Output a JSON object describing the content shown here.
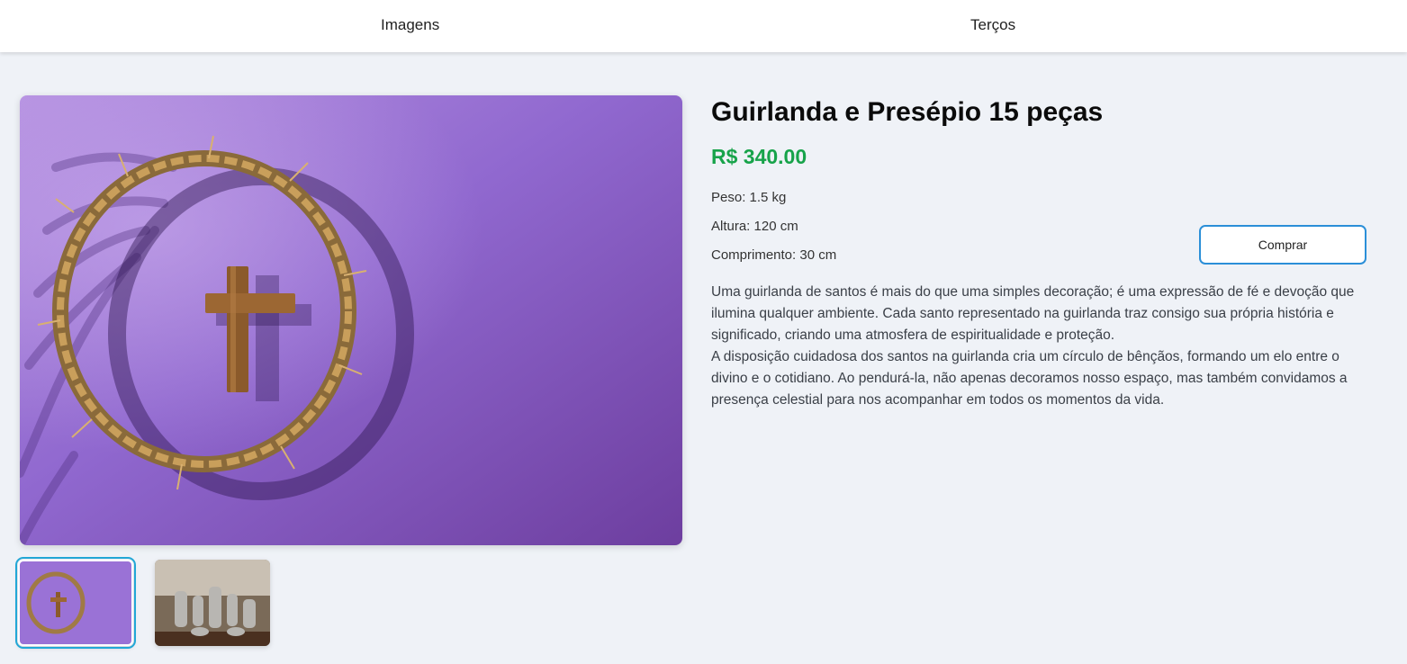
{
  "nav": {
    "items": [
      {
        "label": "Imagens"
      },
      {
        "label": "Terços"
      }
    ]
  },
  "product": {
    "title": "Guirlanda e Presépio 15 peças",
    "price": "R$ 340.00",
    "specs": [
      {
        "text": "Peso: 1.5 kg"
      },
      {
        "text": "Altura: 120 cm"
      },
      {
        "text": "Comprimento: 30 cm"
      }
    ],
    "buy_label": "Comprar",
    "description": [
      "Uma guirlanda de santos é mais do que uma simples decoração; é uma expressão de fé e devoção que ilumina qualquer ambiente. Cada santo representado na guirlanda traz consigo sua própria história e significado, criando uma atmosfera de espiritualidade e proteção.",
      "A disposição cuidadosa dos santos na guirlanda cria um círculo de bênçãos, formando um elo entre o divino e o cotidiano. Ao pendurá-la, não apenas decoramos nosso espaço, mas também convidamos a presença celestial para nos acompanhar em todos os momentos da vida."
    ]
  },
  "gallery": {
    "selected_index": 0,
    "thumbnails": [
      {
        "icon": "crown-of-thorns-cross-photo"
      },
      {
        "icon": "nativity-figurines-photo"
      }
    ]
  },
  "colors": {
    "price": "#17a34a",
    "accent": "#2b8fd8",
    "background": "#eff2f7"
  }
}
